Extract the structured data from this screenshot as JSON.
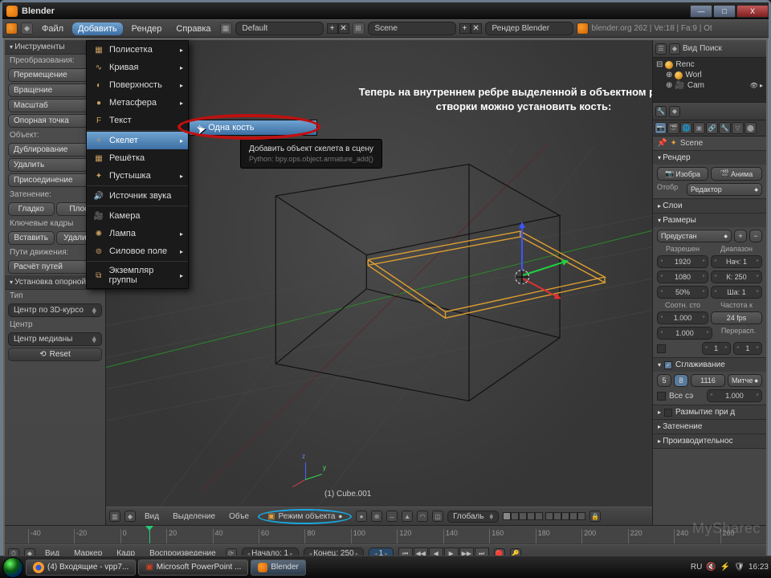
{
  "window": {
    "title": "Blender"
  },
  "win_controls": {
    "min": "—",
    "max": "□",
    "close": "X"
  },
  "menubar": {
    "file": "Файл",
    "add": "Добавить",
    "render": "Рендер",
    "help": "Справка",
    "layout_name": "Default",
    "scene_label": "Scene",
    "engine": "Рендер Blender",
    "info": "blender.org  262 | Ve:18 | Fa:9 | Ot"
  },
  "add_menu": {
    "items": [
      {
        "label": "Полисетка",
        "icon": "▦",
        "sub": true
      },
      {
        "label": "Кривая",
        "icon": "∿",
        "sub": true
      },
      {
        "label": "Поверхность",
        "icon": "◐",
        "sub": true
      },
      {
        "label": "Метасфера",
        "icon": "●",
        "sub": true
      },
      {
        "label": "Текст",
        "icon": "F",
        "sub": false
      },
      {
        "label": "Скелет",
        "icon": "✧",
        "sub": true,
        "highlight": true
      },
      {
        "label": "Решётка",
        "icon": "▦",
        "sub": false
      },
      {
        "label": "Пустышка",
        "icon": "✦",
        "sub": true
      },
      {
        "label": "Источник звука",
        "icon": "🔊",
        "sub": false
      },
      {
        "label": "Камера",
        "icon": "🎥",
        "sub": false
      },
      {
        "label": "Лампа",
        "icon": "✺",
        "sub": true
      },
      {
        "label": "Силовое поле",
        "icon": "⊚",
        "sub": true
      },
      {
        "label": "Экземпляр группы",
        "icon": "⧉",
        "sub": true
      }
    ],
    "submenu": {
      "label": "Одна кость",
      "icon": "✧"
    },
    "tooltip_title": "Добавить объект скелета в сцену",
    "tooltip_py": "Python: bpy.ops.object.armature_add()"
  },
  "instruction": "Теперь на внутреннем ребре выделенной в объектном режиме створки можно установить кость:",
  "left_panel": {
    "tools_hdr": "Инструменты",
    "transform_lbl": "Преобразования:",
    "translate": "Перемещение",
    "rotate": "Вращение",
    "scale": "Масштаб",
    "pivot_lbl": "Опорная точка",
    "object_lbl": "Объект:",
    "duplicate": "Дублирование",
    "delete": "Удалить",
    "join": "Присоединение",
    "shading_lbl": "Затенение:",
    "smooth": "Гладко",
    "flat": "Плос",
    "keyframes_lbl": "Ключевые кадры",
    "insert": "Вставить",
    "remove": "Удалить",
    "motion_lbl": "Пути движения:",
    "calc_paths": "Расчёт путей",
    "set_origin_hdr": "Установка опорной",
    "type_lbl": "Тип",
    "cursor_3d": "Центр по 3D-курсо",
    "center_lbl": "Центр",
    "median": "Центр медианы",
    "reset": "Reset"
  },
  "view3d": {
    "object_name": "(1) Cube.001",
    "hdr": {
      "view": "Вид",
      "select": "Выделение",
      "object": "Объе",
      "mode": "Режим объекта",
      "global": "Глобаль"
    }
  },
  "timeline": {
    "ticks": [
      -40,
      -20,
      0,
      20,
      40,
      60,
      80,
      100,
      120,
      140,
      160,
      180,
      200,
      220,
      240,
      260
    ],
    "hdr": {
      "view": "Вид",
      "marker": "Маркер",
      "frame": "Кадр",
      "playback": "Воспроизведение",
      "start_lbl": "Начало: 1",
      "end_lbl": "Конец: 250",
      "current": "1"
    }
  },
  "right_panel": {
    "hdr_view": "Вид",
    "hdr_search": "Поиск",
    "outliner": [
      {
        "name": "Renc"
      },
      {
        "name": "Worl"
      },
      {
        "name": "Cam"
      }
    ],
    "crumb": "Scene",
    "render_hdr": "Рендер",
    "render_image": "Изобра",
    "render_anim": "Анима",
    "display_lbl": "Отобр",
    "display_val": "Редактор",
    "layers_hdr": "Слои",
    "dims_hdr": "Размеры",
    "preset": "Предустан",
    "res_lbl": "Разрешен",
    "range_lbl": "Диапазон",
    "res_x": "1920",
    "res_y": "1080",
    "res_pct": "50%",
    "frame_start": "Нач: 1",
    "frame_end": "К: 250",
    "frame_step": "Ша: 1",
    "aspect_lbl": "Соотн. сто",
    "fps_lbl": "Частота к",
    "aspect_x": "1.000",
    "fps": "24 fps",
    "aspect_y": "1.000",
    "remap_lbl": "Перерасп.",
    "remap_a": "1",
    "remap_b": "1",
    "aa_hdr": "Сглаживание",
    "aa_chk": true,
    "aa_samples_a": "5",
    "aa_samples_b": "8",
    "aa_samples_c": "1116",
    "aa_filter": "Митче",
    "full_sample": "Все сэ",
    "filter_size": "1.000",
    "mblur_hdr": "Размытие при д",
    "shading_hdr": "Затенение",
    "perf_hdr": "Производительнос"
  },
  "taskbar": {
    "items": [
      {
        "label": "(4) Входящие - vpp7...",
        "icon": "firefox"
      },
      {
        "label": "Microsoft PowerPoint ...",
        "icon": "ppt"
      },
      {
        "label": "Blender",
        "icon": "blender",
        "active": true
      }
    ],
    "lang": "RU",
    "clock": "16:23"
  },
  "watermark": "MySharec"
}
